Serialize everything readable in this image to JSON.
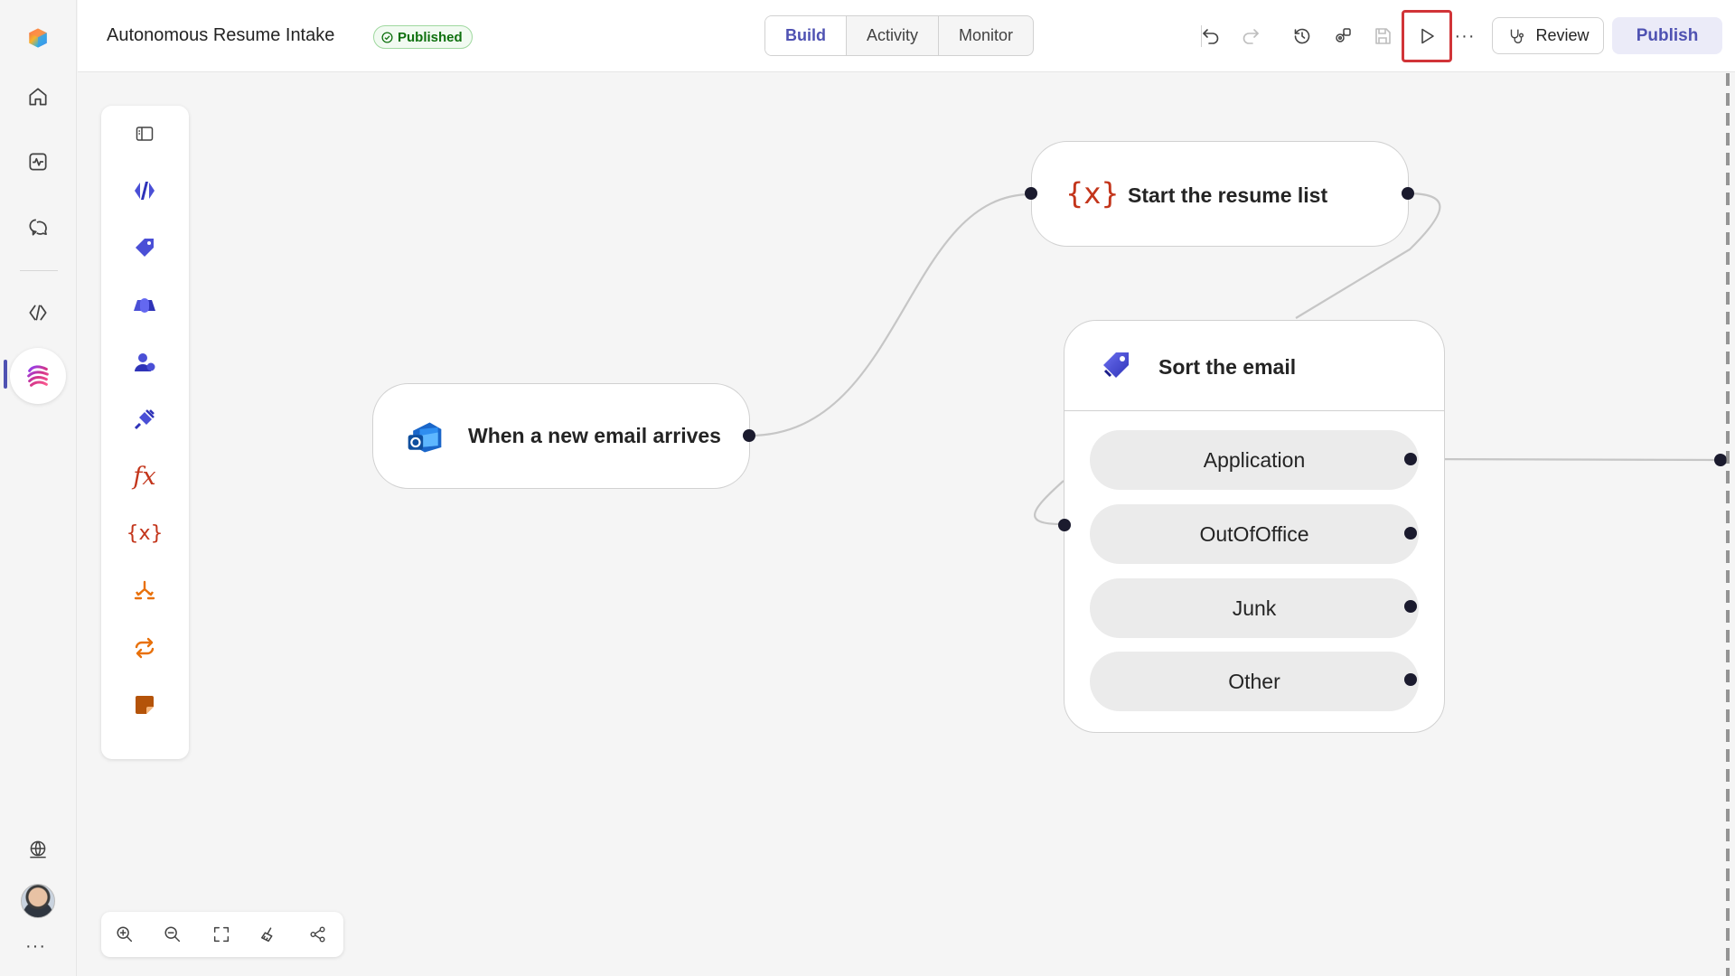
{
  "header": {
    "title": "Autonomous Resume Intake",
    "status": "Published",
    "tabs": [
      "Build",
      "Activity",
      "Monitor"
    ],
    "active_tab": "Build",
    "review_label": "Review",
    "publish_label": "Publish",
    "more_label": "···"
  },
  "rail": {
    "active_item": "agent-flows",
    "more_label": "···"
  },
  "canvas": {
    "trigger_node": "When a new email arrives",
    "variable_node": "Start the resume list",
    "sort_node": {
      "title": "Sort the email",
      "branches": [
        "Application",
        "OutOfOffice",
        "Junk",
        "Other"
      ]
    }
  },
  "palette_icons": [
    "toggle-panel-icon",
    "code-icon",
    "tag-icon",
    "copilot-icon",
    "human-agent-icon",
    "connector-icon",
    "function-icon",
    "variable-icon",
    "condition-icon",
    "loop-icon",
    "sticky-note-icon"
  ],
  "zoom_controls": [
    "zoom-in-icon",
    "zoom-out-icon",
    "fit-to-screen-icon",
    "clean-up-icon",
    "minimap-icon"
  ],
  "colors": {
    "accent": "#4f52b2",
    "highlight": "#d13438",
    "success": "#0e700e",
    "variable": "#c3351b",
    "loop": "#e8700a"
  }
}
